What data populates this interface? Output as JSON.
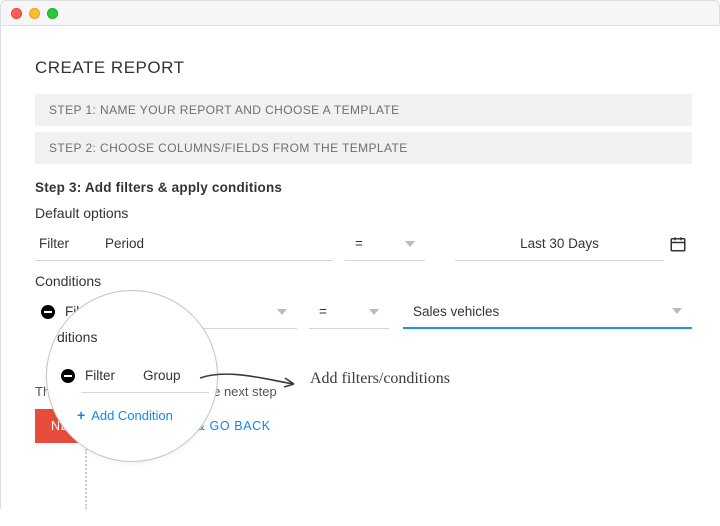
{
  "window": {
    "title": "CREATE REPORT"
  },
  "steps": {
    "s1": "STEP 1: NAME YOUR REPORT AND CHOOSE A TEMPLATE",
    "s2": "STEP 2: CHOOSE COLUMNS/FIELDS FROM THE TEMPLATE",
    "s3": "Step 3: Add filters & apply conditions"
  },
  "default_options": {
    "label": "Default options",
    "filter_label": "Filter",
    "field": "Period",
    "operator": "=",
    "value": "Last 30 Days"
  },
  "conditions": {
    "label": "Conditions",
    "filter_label": "Filter",
    "field": "Group",
    "operator": "=",
    "value": "Sales vehicles",
    "add_label": "Add Condition"
  },
  "proceed_text": "That's done now; proceed to the next step",
  "actions": {
    "next": "NEXT STEP",
    "save": "SAVE & GO BACK"
  },
  "annotation": "Add filters/conditions",
  "colors": {
    "primary_red": "#e74c3c",
    "link_blue": "#1189e6",
    "accent_blue": "#1f97e0"
  }
}
